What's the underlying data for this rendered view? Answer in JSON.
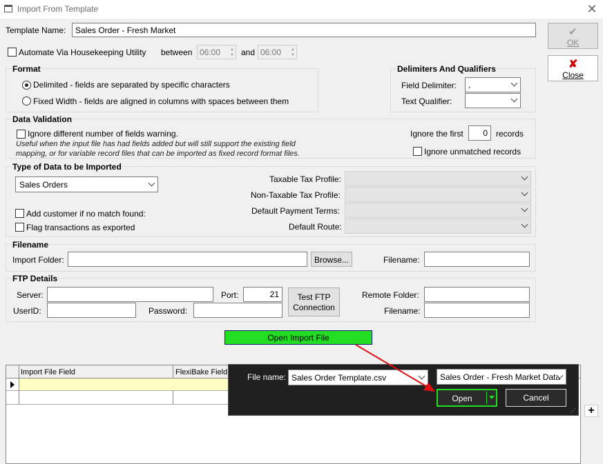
{
  "window": {
    "title": "Import From Template"
  },
  "template": {
    "label": "Template Name:",
    "value": "Sales Order - Fresh Market"
  },
  "automate": {
    "label": "Automate Via Housekeeping Utility",
    "between_label": "between",
    "from_time": "06:00",
    "and_label": "and",
    "to_time": "06:00"
  },
  "buttons": {
    "ok": "OK",
    "close": "Close"
  },
  "format": {
    "title": "Format",
    "delimited": "Delimited - fields are separated by specific characters",
    "fixed": "Fixed Width - fields are aligned in columns with spaces between them"
  },
  "delimiters": {
    "title": "Delimiters And Qualifiers",
    "field_label": "Field Delimiter:",
    "field_value": ",",
    "qualifier_label": "Text Qualifier:",
    "qualifier_value": ""
  },
  "validation": {
    "title": "Data Validation",
    "ignore_label": "Ignore different number of fields warning.",
    "note_line1": "Useful when the input file has had fields added but will still support the existing field",
    "note_line2": "mapping, or for variable record files that can be imported as fixed record format files.",
    "ignore_first_label": "Ignore the first",
    "ignore_first_value": "0",
    "records_label": "records",
    "unmatched_label": "Ignore unmatched records"
  },
  "data_type": {
    "title": "Type of Data to be Imported",
    "selected": "Sales Orders",
    "add_customer": "Add customer if no match found:",
    "flag_exported": "Flag transactions as exported",
    "taxable_label": "Taxable Tax Profile:",
    "nontaxable_label": "Non-Taxable Tax Profile:",
    "payment_label": "Default Payment Terms:",
    "route_label": "Default Route:"
  },
  "filename": {
    "title": "Filename",
    "folder_label": "Import Folder:",
    "browse": "Browse...",
    "filename_label": "Filename:"
  },
  "ftp": {
    "title": "FTP Details",
    "server_label": "Server:",
    "port_label": "Port:",
    "port_value": "21",
    "test_line1": "Test FTP",
    "test_line2": "Connection",
    "remote_label": "Remote Folder:",
    "userid_label": "UserID:",
    "password_label": "Password:",
    "filename_label": "Filename:"
  },
  "open_import": {
    "label": "Open Import File"
  },
  "grid": {
    "columns": [
      "Import File Field",
      "FlexiBake Field N"
    ]
  },
  "file_dialog": {
    "name_label": "File name:",
    "name_value": "Sales Order Template.csv",
    "filter_value": "Sales Order - Fresh Market Data",
    "open": "Open",
    "cancel": "Cancel"
  },
  "colors": {
    "accent_green": "#22dd22",
    "arrow_red": "#dd1111",
    "dialog_bg": "#202020"
  }
}
